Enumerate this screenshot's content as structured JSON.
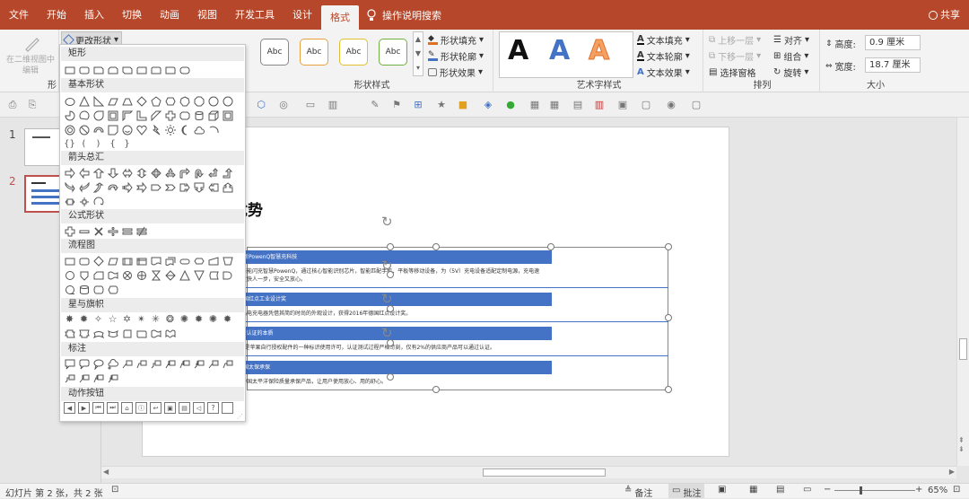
{
  "menu": {
    "tabs": [
      "文件",
      "开始",
      "插入",
      "切换",
      "动画",
      "视图",
      "开发工具",
      "设计",
      "格式"
    ],
    "active": "格式",
    "tellme": "操作说明搜索",
    "share": "共享"
  },
  "ribbon": {
    "edit_in_2d": "在二维视图中编辑",
    "change_shape": "更改形状",
    "styles": [
      "Abc",
      "Abc",
      "Abc",
      "Abc",
      "Abc",
      "Abc",
      "Abc"
    ],
    "shape_fill": "形状填充",
    "shape_outline": "形状轮廓",
    "shape_effect": "形状效果",
    "shape_style_label": "形状样式",
    "text_fill": "文本填充",
    "text_outline": "文本轮廓",
    "text_effect": "文本效果",
    "art_label": "艺术字样式",
    "bring_forward": "上移一层",
    "send_backward": "下移一层",
    "selection_pane": "选择窗格",
    "align": "对齐",
    "group": "组合",
    "rotate": "旋转",
    "arrange_label": "排列",
    "height_label": "高度:",
    "height_value": "0.9 厘米",
    "width_label": "宽度:",
    "width_value": "18.7 厘米",
    "size_label": "大小",
    "group_truncated": "形"
  },
  "dropdown": {
    "categories": [
      "矩形",
      "基本形状",
      "箭头总汇",
      "公式形状",
      "流程图",
      "星与旗帜",
      "标注",
      "动作按钮"
    ]
  },
  "thumbs": [
    {
      "num": "1"
    },
    {
      "num": "2"
    }
  ],
  "slide": {
    "title": "优势",
    "items": [
      {
        "heading": "新PowenQ智慧充科技",
        "body": "搭能闪充智慧PowenQ，通过核心智能识别芯片，智能匹配手机、平板等移动设备，为（5V）充电设备适配定制电源，充电速",
        "body2": "度快人一步，安全又放心。"
      },
      {
        "heading": "国红点工业设计奖",
        "body": "品电充电器凭借其简约时尚的外观设计，获得2016年德国红点设计奖。",
        "body2": ""
      },
      {
        "heading": "F认证的本质",
        "body": "F是苹果自行授权配件的一种标识使用许可，认证测试过程严格苛刻，仅有2%的供应商产品可以通过认证。",
        "body2": ""
      },
      {
        "heading": "国太保承保",
        "body": "中国太平洋保险质量承保产品，让用户使用放心、用的舒心。",
        "body2": ""
      }
    ]
  },
  "status": {
    "slide_info": "幻灯片 第 2 张，共 2 张",
    "notes": "备注",
    "comments": "批注",
    "zoom": "65%"
  }
}
